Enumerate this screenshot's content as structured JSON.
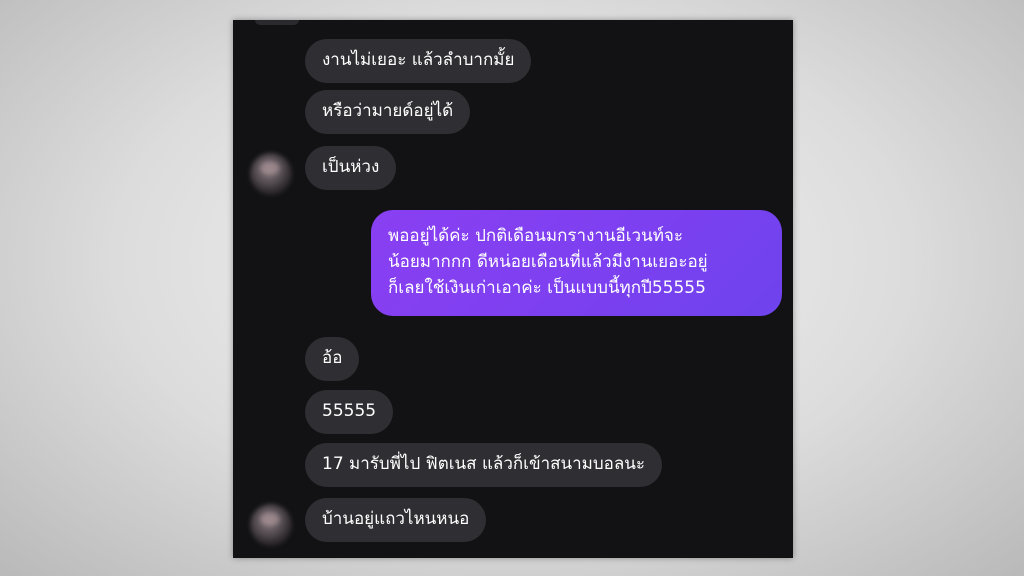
{
  "messages": [
    {
      "text": "งานไม่เยอะ แล้วลำบากมั้ย",
      "side": "incoming"
    },
    {
      "text": "หรือว่ามายด์อยู่ได้",
      "side": "incoming"
    },
    {
      "text": "เป็นห่วง",
      "side": "incoming"
    },
    {
      "lines": [
        "พออยู่ได้ค่ะ ปกติเดือนมกรางานอีเวนท์จะ",
        "น้อยมากกก ดีหน่อยเดือนที่แล้วมีงานเยอะอยู่",
        "ก็เลยใช้เงินเก่าเอาค่ะ เป็นแบบนี้ทุกปี55555"
      ],
      "side": "outgoing"
    },
    {
      "text": "อ้อ",
      "side": "incoming"
    },
    {
      "text": "55555",
      "side": "incoming"
    },
    {
      "text": "17 มารับพี่ไป ฟิตเนส แล้วก็เข้าสนามบอลนะ",
      "side": "incoming"
    },
    {
      "text": "บ้านอยู่แถวไหนหนอ",
      "side": "incoming"
    }
  ],
  "colors": {
    "panel_background": "#121214",
    "incoming_bubble": "#2f2f33",
    "outgoing_bubble": "#7b40f0",
    "text": "#ffffff"
  },
  "icons": {
    "avatar_1": "blurred-avatar",
    "avatar_2": "blurred-avatar"
  }
}
